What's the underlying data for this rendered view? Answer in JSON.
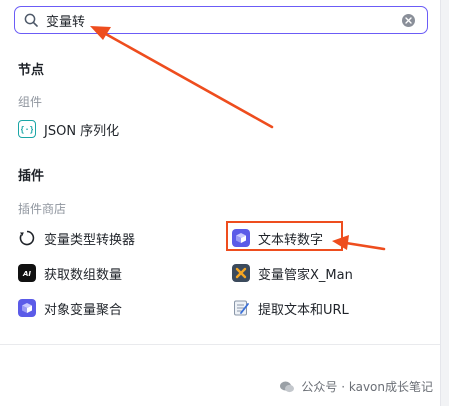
{
  "search": {
    "value": "变量转"
  },
  "sections": {
    "nodes": "节点",
    "components": "组件",
    "plugins": "插件",
    "plugin_store": "插件商店"
  },
  "components": [
    {
      "label": "JSON 序列化",
      "icon": "json-braces-icon"
    }
  ],
  "plugins": [
    {
      "label": "变量类型转换器",
      "icon": "refresh-circle-icon"
    },
    {
      "label": "文本转数字",
      "icon": "cube-icon"
    },
    {
      "label": "获取数组数量",
      "icon": "ai-badge-icon"
    },
    {
      "label": "变量管家X_Man",
      "icon": "cross-box-icon"
    },
    {
      "label": "对象变量聚合",
      "icon": "cube-icon"
    },
    {
      "label": "提取文本和URL",
      "icon": "notepad-icon"
    }
  ],
  "icon_badge_text": "AI",
  "watermark": "公众号 · kavon成长笔记",
  "colors": {
    "accent": "#6b5cf6",
    "annotation": "#ee4d1e",
    "json_icon": "#1aa6a6",
    "cube_icon": "#5b5be8"
  }
}
